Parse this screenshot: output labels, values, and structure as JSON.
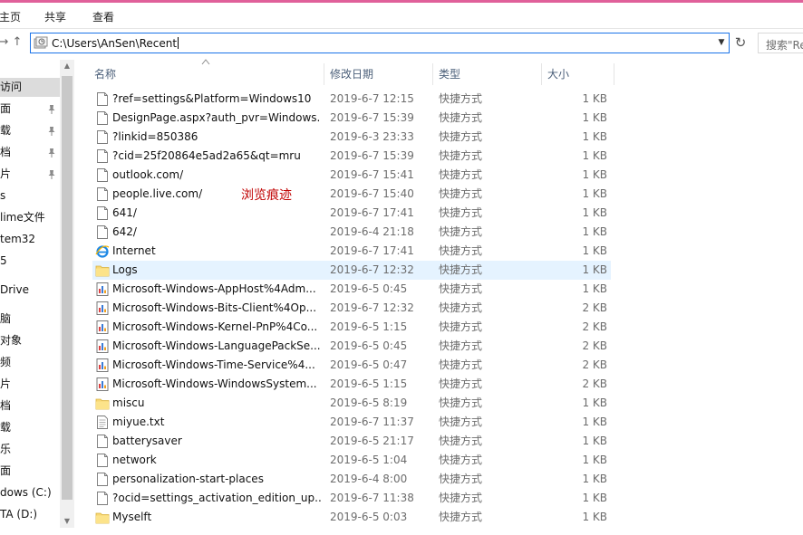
{
  "ribbon": {
    "tabs": [
      "主页",
      "共享",
      "查看"
    ]
  },
  "nav": {
    "back": "←",
    "forward": "→",
    "up": "↑"
  },
  "address": {
    "path": "C:\\Users\\AnSen\\Recent",
    "dropdown": "⌄",
    "refresh": "↻"
  },
  "search": {
    "placeholder": "搜索\"Re"
  },
  "sidebar": {
    "items": [
      {
        "label": "访问",
        "pinned": false,
        "selected": true
      },
      {
        "label": "面",
        "pinned": true
      },
      {
        "label": "载",
        "pinned": true
      },
      {
        "label": "档",
        "pinned": true
      },
      {
        "label": "片",
        "pinned": true
      },
      {
        "label": "s",
        "pinned": false
      },
      {
        "label": "lime文件",
        "pinned": false
      },
      {
        "label": "tem32",
        "pinned": false
      },
      {
        "label": "5",
        "pinned": false
      },
      {
        "label": "Drive",
        "pinned": false
      },
      {
        "label": "脑",
        "pinned": false
      },
      {
        "label": "对象",
        "pinned": false
      },
      {
        "label": "频",
        "pinned": false
      },
      {
        "label": "片",
        "pinned": false
      },
      {
        "label": "档",
        "pinned": false
      },
      {
        "label": "载",
        "pinned": false
      },
      {
        "label": "乐",
        "pinned": false
      },
      {
        "label": "面",
        "pinned": false
      },
      {
        "label": "dows (C:)",
        "pinned": false
      },
      {
        "label": "TA (D:)",
        "pinned": false
      }
    ]
  },
  "columns": {
    "name": "名称",
    "date": "修改日期",
    "type": "类型",
    "size": "大小"
  },
  "files": [
    {
      "name": "?ref=settings&Platform=Windows10",
      "date": "2019-6-7 12:15",
      "type": "快捷方式",
      "size": "1 KB",
      "icon": "page-icon"
    },
    {
      "name": "DesignPage.aspx?auth_pvr=Windows...",
      "date": "2019-6-7 15:39",
      "type": "快捷方式",
      "size": "1 KB",
      "icon": "page-icon"
    },
    {
      "name": "?linkid=850386",
      "date": "2019-6-3 23:33",
      "type": "快捷方式",
      "size": "1 KB",
      "icon": "page-icon"
    },
    {
      "name": "?cid=25f20864e5ad2a65&qt=mru",
      "date": "2019-6-7 15:39",
      "type": "快捷方式",
      "size": "1 KB",
      "icon": "page-icon"
    },
    {
      "name": "outlook.com/",
      "date": "2019-6-7 15:41",
      "type": "快捷方式",
      "size": "1 KB",
      "icon": "page-icon"
    },
    {
      "name": "people.live.com/",
      "date": "2019-6-7 15:40",
      "type": "快捷方式",
      "size": "1 KB",
      "icon": "page-icon"
    },
    {
      "name": "641/",
      "date": "2019-6-7 17:41",
      "type": "快捷方式",
      "size": "1 KB",
      "icon": "page-icon"
    },
    {
      "name": "642/",
      "date": "2019-6-4 21:18",
      "type": "快捷方式",
      "size": "1 KB",
      "icon": "page-icon"
    },
    {
      "name": "Internet",
      "date": "2019-6-7 17:41",
      "type": "快捷方式",
      "size": "1 KB",
      "icon": "ie-icon"
    },
    {
      "name": "Logs",
      "date": "2019-6-7 12:32",
      "type": "快捷方式",
      "size": "1 KB",
      "icon": "folder-icon",
      "highlighted": true
    },
    {
      "name": "Microsoft-Windows-AppHost%4Adm...",
      "date": "2019-6-5 0:45",
      "type": "快捷方式",
      "size": "1 KB",
      "icon": "log-icon"
    },
    {
      "name": "Microsoft-Windows-Bits-Client%4Op...",
      "date": "2019-6-7 12:32",
      "type": "快捷方式",
      "size": "2 KB",
      "icon": "log-icon"
    },
    {
      "name": "Microsoft-Windows-Kernel-PnP%4Co...",
      "date": "2019-6-5 1:15",
      "type": "快捷方式",
      "size": "2 KB",
      "icon": "log-icon"
    },
    {
      "name": "Microsoft-Windows-LanguagePackSe...",
      "date": "2019-6-5 0:45",
      "type": "快捷方式",
      "size": "2 KB",
      "icon": "log-icon"
    },
    {
      "name": "Microsoft-Windows-Time-Service%4...",
      "date": "2019-6-5 0:47",
      "type": "快捷方式",
      "size": "2 KB",
      "icon": "log-icon"
    },
    {
      "name": "Microsoft-Windows-WindowsSystem...",
      "date": "2019-6-5 1:15",
      "type": "快捷方式",
      "size": "2 KB",
      "icon": "log-icon"
    },
    {
      "name": "miscu",
      "date": "2019-6-5 8:19",
      "type": "快捷方式",
      "size": "1 KB",
      "icon": "folder-icon"
    },
    {
      "name": "miyue.txt",
      "date": "2019-6-7 11:37",
      "type": "快捷方式",
      "size": "1 KB",
      "icon": "text-file-icon"
    },
    {
      "name": "batterysaver",
      "date": "2019-6-5 21:17",
      "type": "快捷方式",
      "size": "1 KB",
      "icon": "page-icon"
    },
    {
      "name": "network",
      "date": "2019-6-5 1:04",
      "type": "快捷方式",
      "size": "1 KB",
      "icon": "page-icon"
    },
    {
      "name": "personalization-start-places",
      "date": "2019-6-4 8:00",
      "type": "快捷方式",
      "size": "1 KB",
      "icon": "page-icon"
    },
    {
      "name": "?ocid=settings_activation_edition_up...",
      "date": "2019-6-7 11:38",
      "type": "快捷方式",
      "size": "1 KB",
      "icon": "page-icon"
    },
    {
      "name": "Myselft",
      "date": "2019-6-5 0:03",
      "type": "快捷方式",
      "size": "1 KB",
      "icon": "folder-icon"
    }
  ],
  "annotation": {
    "text": "浏览痕迹",
    "color": "#c00000"
  },
  "colors": {
    "accent": "#1a73e8",
    "titlebar_line": "#e0609a",
    "highlight": "#e5f3ff",
    "header_text": "#4c607a"
  }
}
